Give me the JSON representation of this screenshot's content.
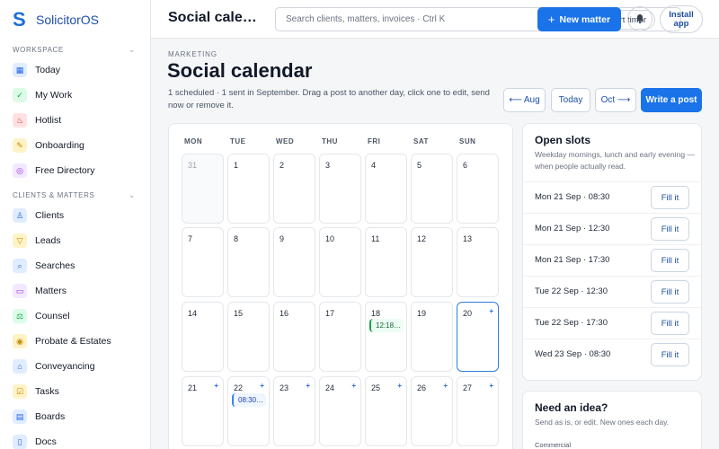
{
  "brand": {
    "logo_letter": "S",
    "name": "SolicitorOS"
  },
  "sidebar": {
    "sections": [
      {
        "title": "WORKSPACE",
        "items": [
          {
            "label": "Today",
            "icon": "grid-icon",
            "color": "#2563eb",
            "bg": "#e0ecff",
            "glyph": "▦"
          },
          {
            "label": "My Work",
            "icon": "check-icon",
            "color": "#16a34a",
            "bg": "#dcfce7",
            "glyph": "✓"
          },
          {
            "label": "Hotlist",
            "icon": "flame-icon",
            "color": "#dc2626",
            "bg": "#fee2e2",
            "glyph": "♨"
          },
          {
            "label": "Onboarding",
            "icon": "brush-icon",
            "color": "#ca8a04",
            "bg": "#fef3c7",
            "glyph": "✎"
          },
          {
            "label": "Free Directory",
            "icon": "search-icon",
            "color": "#9333ea",
            "bg": "#f3e8ff",
            "glyph": "◎"
          }
        ]
      },
      {
        "title": "CLIENTS & MATTERS",
        "items": [
          {
            "label": "Clients",
            "icon": "user-icon",
            "color": "#2563eb",
            "bg": "#e0ecff",
            "glyph": "♙"
          },
          {
            "label": "Leads",
            "icon": "filter-icon",
            "color": "#ca8a04",
            "bg": "#fef3c7",
            "glyph": "▽"
          },
          {
            "label": "Searches",
            "icon": "magnifier-icon",
            "color": "#2563eb",
            "bg": "#e0ecff",
            "glyph": "⌕"
          },
          {
            "label": "Matters",
            "icon": "folder-icon",
            "color": "#9333ea",
            "bg": "#f3e8ff",
            "glyph": "▭"
          },
          {
            "label": "Counsel",
            "icon": "scales-icon",
            "color": "#16a34a",
            "bg": "#dcfce7",
            "glyph": "⚖"
          },
          {
            "label": "Probate & Estates",
            "icon": "coin-icon",
            "color": "#ca8a04",
            "bg": "#fef3c7",
            "glyph": "◉"
          },
          {
            "label": "Conveyancing",
            "icon": "house-icon",
            "color": "#2563eb",
            "bg": "#e0ecff",
            "glyph": "⌂"
          },
          {
            "label": "Tasks",
            "icon": "task-icon",
            "color": "#ca8a04",
            "bg": "#fef3c7",
            "glyph": "☑"
          },
          {
            "label": "Boards",
            "icon": "board-icon",
            "color": "#2563eb",
            "bg": "#e0ecff",
            "glyph": "▤"
          },
          {
            "label": "Docs",
            "icon": "doc-icon",
            "color": "#2563eb",
            "bg": "#e0ecff",
            "glyph": "▯"
          }
        ]
      }
    ]
  },
  "topbar": {
    "title": "Social calendar",
    "search_placeholder": "Search clients, matters, invoices · Ctrl K",
    "start_timer": "Start timer",
    "new_matter": "New matter",
    "install_line1": "Install",
    "install_line2": "app"
  },
  "header": {
    "eyebrow": "MARKETING",
    "title": "Social calendar",
    "subtitle": "1 scheduled · 1 sent in September. Drag a post to another day, click one to edit, send now or remove it.",
    "prev_month": "⟵ Aug",
    "today": "Today",
    "next_month": "Oct ⟶",
    "write_post": "Write a post"
  },
  "calendar": {
    "weekdays": [
      "MON",
      "TUE",
      "WED",
      "THU",
      "FRI",
      "SAT",
      "SUN"
    ],
    "weeks": [
      [
        {
          "day": "31",
          "muted": true
        },
        {
          "day": "1"
        },
        {
          "day": "2"
        },
        {
          "day": "3"
        },
        {
          "day": "4"
        },
        {
          "day": "5"
        },
        {
          "day": "6"
        }
      ],
      [
        {
          "day": "7"
        },
        {
          "day": "8"
        },
        {
          "day": "9"
        },
        {
          "day": "10"
        },
        {
          "day": "11"
        },
        {
          "day": "12"
        },
        {
          "day": "13"
        }
      ],
      [
        {
          "day": "14"
        },
        {
          "day": "15"
        },
        {
          "day": "16"
        },
        {
          "day": "17"
        },
        {
          "day": "18",
          "chip": "12:18…",
          "chip_color": "green"
        },
        {
          "day": "19"
        },
        {
          "day": "20",
          "today": true,
          "plus": true
        }
      ],
      [
        {
          "day": "21",
          "plus": true
        },
        {
          "day": "22",
          "plus": true,
          "chip": "08:30…",
          "chip_color": "blue"
        },
        {
          "day": "23",
          "plus": true
        },
        {
          "day": "24",
          "plus": true
        },
        {
          "day": "25",
          "plus": true
        },
        {
          "day": "26",
          "plus": true
        },
        {
          "day": "27",
          "plus": true
        }
      ]
    ]
  },
  "open_slots": {
    "title": "Open slots",
    "subtitle": "Weekday mornings, lunch and early evening — when people actually read.",
    "fill_label": "Fill it",
    "slots": [
      "Mon 21 Sep · 08:30",
      "Mon 21 Sep · 12:30",
      "Mon 21 Sep · 17:30",
      "Tue 22 Sep · 12:30",
      "Tue 22 Sep · 17:30",
      "Wed 23 Sep · 08:30"
    ]
  },
  "idea": {
    "title": "Need an idea?",
    "subtitle": "Send as is, or edit. New ones each day.",
    "category": "Commercial"
  },
  "plus_sign": "+"
}
